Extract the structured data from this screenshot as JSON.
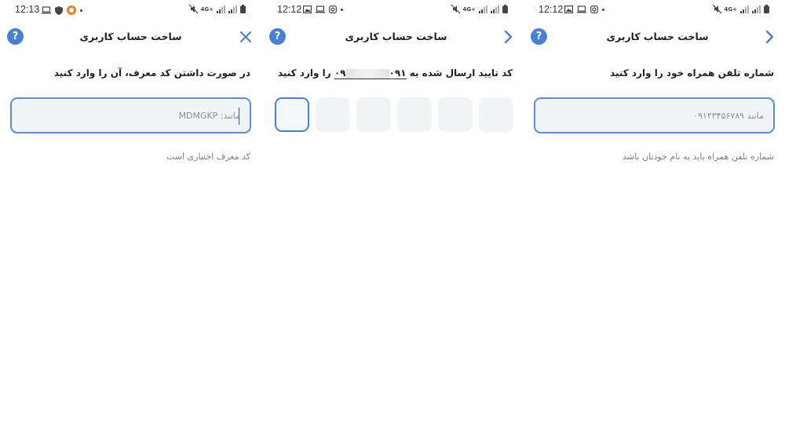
{
  "colors": {
    "accent": "#4a7fd6",
    "field_bg": "#f1f5f7",
    "hint": "#7a7f85"
  },
  "screens": [
    {
      "status": {
        "time": "12:13",
        "network": "4G+"
      },
      "appbar": {
        "title": "ساخت حساب کاربری",
        "help": "?",
        "nav_icon": "close-icon"
      },
      "instruction": "در صورت داشتن کد معرف، آن را وارد کنید",
      "input": {
        "placeholder": "مانند: MDMGKP",
        "value": ""
      },
      "hint": "کد معرف اختیاری است"
    },
    {
      "status": {
        "time": "12:12",
        "network": "4G+"
      },
      "appbar": {
        "title": "ساخت حساب کاربری",
        "help": "?",
        "nav_icon": "chevron-right-icon"
      },
      "instruction_prefix": "کد تایید ارسال شده به",
      "phone_start": "۰۹۱",
      "phone_end": "۰۹",
      "instruction_suffix": "را وارد کنید",
      "otp": {
        "digits": [
          "",
          "",
          "",
          "",
          "",
          ""
        ],
        "active_index": 5
      }
    },
    {
      "status": {
        "time": "12:12",
        "network": "4G+"
      },
      "appbar": {
        "title": "ساخت حساب کاربری",
        "help": "?",
        "nav_icon": "chevron-right-icon"
      },
      "instruction": "شماره تلفن همراه خود را وارد کنید",
      "input": {
        "placeholder": "مانند ۰۹۱۲۳۴۵۶۷۸۹",
        "value": ""
      },
      "hint": "شماره تلفن همراه باید به نام خودتان باشد"
    }
  ]
}
